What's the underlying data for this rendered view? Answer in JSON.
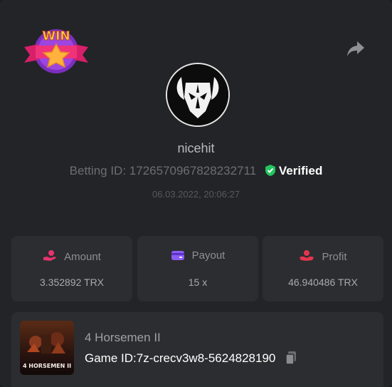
{
  "badge": {
    "text": "WIN",
    "icon": "win-star-ribbon"
  },
  "share": {
    "icon": "share-arrow-icon"
  },
  "user": {
    "name": "nicehit",
    "avatar": "bull-skull-avatar"
  },
  "bet": {
    "id_label": "Betting ID:",
    "id_value": "172657096782823271​1",
    "verified_label": "Verified",
    "datetime": "06.03.2022, 20:06:27"
  },
  "stats": [
    {
      "label": "Amount",
      "value": "3.352892 TRX",
      "icon": "hand-coin-icon",
      "color": "#e8336d"
    },
    {
      "label": "Payout",
      "value": "15 x",
      "icon": "wallet-card-icon",
      "color": "#8c5cf6"
    },
    {
      "label": "Profit",
      "value": "46.940486 TRX",
      "icon": "hand-profit-icon",
      "color": "#e6344f"
    }
  ],
  "game": {
    "name": "4 Horsemen II",
    "id_label": "Game ID:",
    "id_value": "7z-crecv3w8-5624828190",
    "thumb_text": "4 HORSEMEN II"
  },
  "colors": {
    "verified": "#22c55e",
    "panel": "#232427",
    "card": "#2c2d30"
  }
}
